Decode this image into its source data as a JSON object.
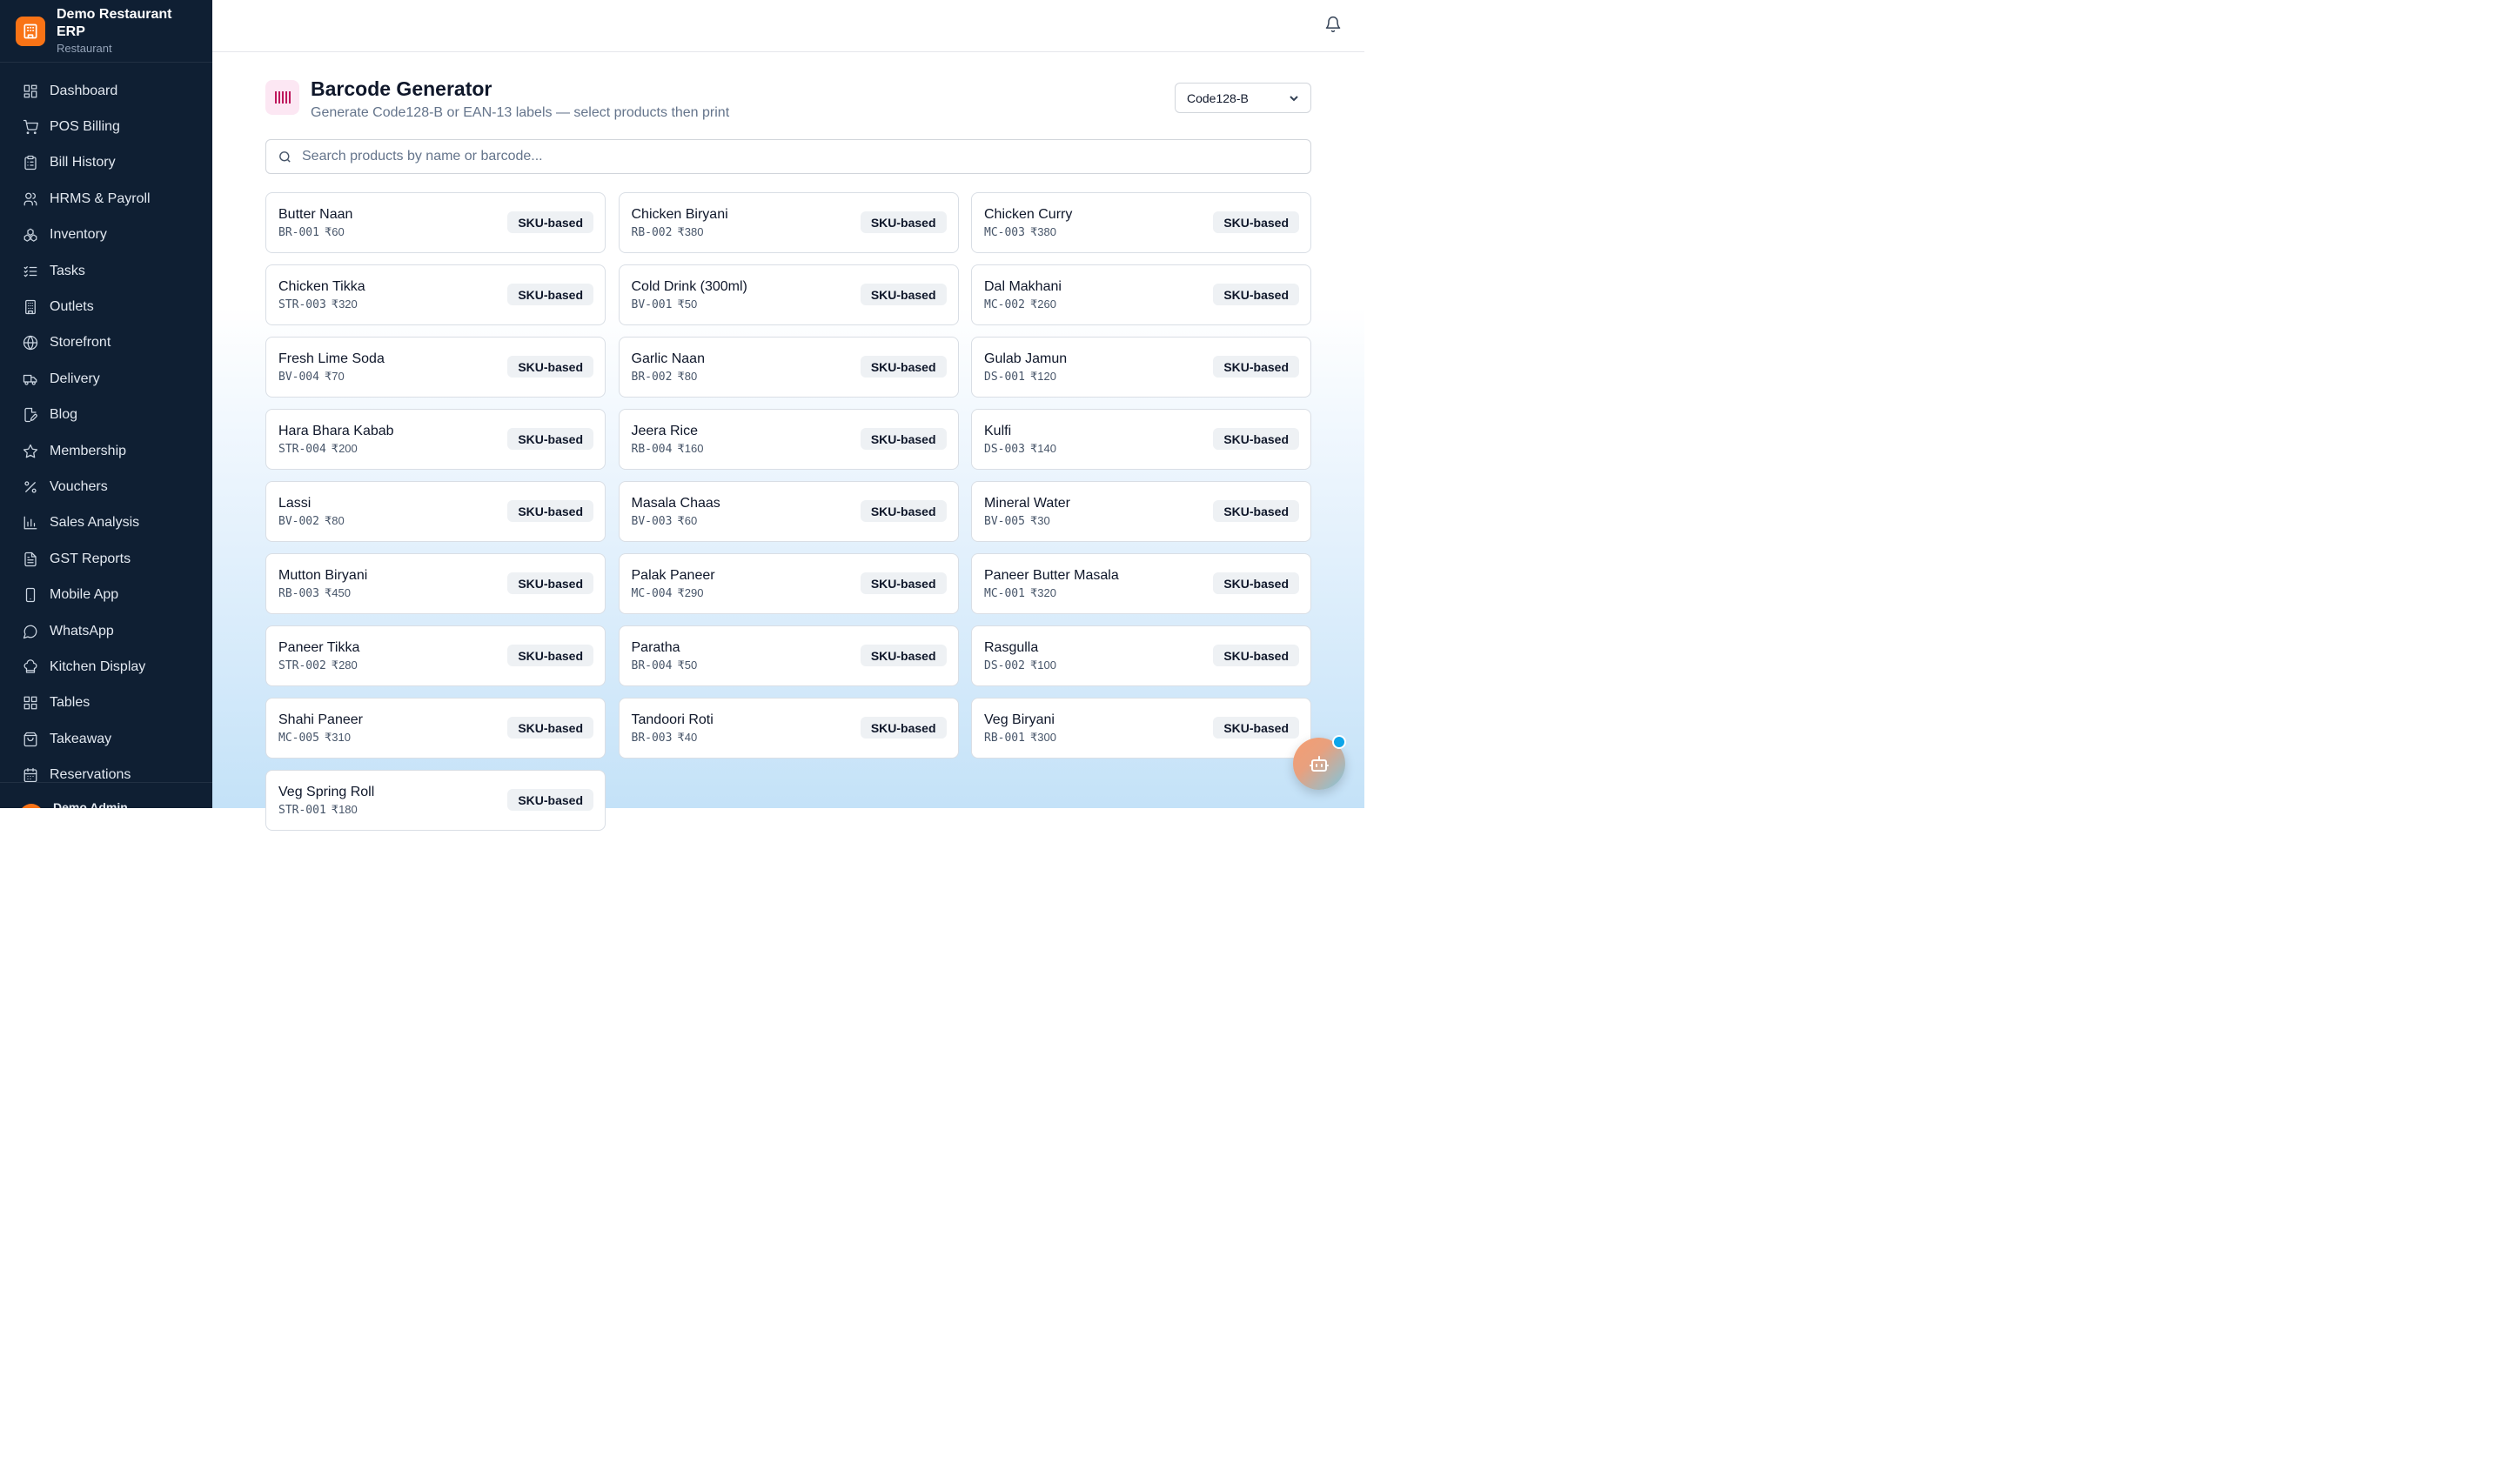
{
  "app": {
    "name": "Demo Restaurant ERP",
    "subtitle": "Restaurant"
  },
  "sidebar": {
    "items": [
      {
        "label": "Dashboard",
        "icon": "dashboard-icon"
      },
      {
        "label": "POS Billing",
        "icon": "cart-icon"
      },
      {
        "label": "Bill History",
        "icon": "clipboard-icon"
      },
      {
        "label": "HRMS & Payroll",
        "icon": "users-icon"
      },
      {
        "label": "Inventory",
        "icon": "boxes-icon"
      },
      {
        "label": "Tasks",
        "icon": "checklist-icon"
      },
      {
        "label": "Outlets",
        "icon": "building-icon"
      },
      {
        "label": "Storefront",
        "icon": "globe-icon"
      },
      {
        "label": "Delivery",
        "icon": "truck-icon"
      },
      {
        "label": "Blog",
        "icon": "file-edit-icon"
      },
      {
        "label": "Membership",
        "icon": "star-icon"
      },
      {
        "label": "Vouchers",
        "icon": "percent-icon"
      },
      {
        "label": "Sales Analysis",
        "icon": "bar-chart-icon"
      },
      {
        "label": "GST Reports",
        "icon": "file-text-icon"
      },
      {
        "label": "Mobile App",
        "icon": "smartphone-icon"
      },
      {
        "label": "WhatsApp",
        "icon": "message-circle-icon"
      },
      {
        "label": "Kitchen Display",
        "icon": "chef-hat-icon"
      },
      {
        "label": "Tables",
        "icon": "grid-icon"
      },
      {
        "label": "Takeaway",
        "icon": "shopping-bag-icon"
      },
      {
        "label": "Reservations",
        "icon": "calendar-icon"
      }
    ],
    "user_name": "Demo Admin"
  },
  "page": {
    "title": "Barcode Generator",
    "subtitle": "Generate Code128-B or EAN-13 labels — select products then print",
    "format_value": "Code128-B",
    "search_placeholder": "Search products by name or barcode..."
  },
  "products": [
    {
      "name": "Butter Naan",
      "code": "BR-001",
      "price": "₹60",
      "badge": "SKU-based"
    },
    {
      "name": "Chicken Biryani",
      "code": "RB-002",
      "price": "₹380",
      "badge": "SKU-based"
    },
    {
      "name": "Chicken Curry",
      "code": "MC-003",
      "price": "₹380",
      "badge": "SKU-based"
    },
    {
      "name": "Chicken Tikka",
      "code": "STR-003",
      "price": "₹320",
      "badge": "SKU-based"
    },
    {
      "name": "Cold Drink (300ml)",
      "code": "BV-001",
      "price": "₹50",
      "badge": "SKU-based"
    },
    {
      "name": "Dal Makhani",
      "code": "MC-002",
      "price": "₹260",
      "badge": "SKU-based"
    },
    {
      "name": "Fresh Lime Soda",
      "code": "BV-004",
      "price": "₹70",
      "badge": "SKU-based"
    },
    {
      "name": "Garlic Naan",
      "code": "BR-002",
      "price": "₹80",
      "badge": "SKU-based"
    },
    {
      "name": "Gulab Jamun",
      "code": "DS-001",
      "price": "₹120",
      "badge": "SKU-based"
    },
    {
      "name": "Hara Bhara Kabab",
      "code": "STR-004",
      "price": "₹200",
      "badge": "SKU-based"
    },
    {
      "name": "Jeera Rice",
      "code": "RB-004",
      "price": "₹160",
      "badge": "SKU-based"
    },
    {
      "name": "Kulfi",
      "code": "DS-003",
      "price": "₹140",
      "badge": "SKU-based"
    },
    {
      "name": "Lassi",
      "code": "BV-002",
      "price": "₹80",
      "badge": "SKU-based"
    },
    {
      "name": "Masala Chaas",
      "code": "BV-003",
      "price": "₹60",
      "badge": "SKU-based"
    },
    {
      "name": "Mineral Water",
      "code": "BV-005",
      "price": "₹30",
      "badge": "SKU-based"
    },
    {
      "name": "Mutton Biryani",
      "code": "RB-003",
      "price": "₹450",
      "badge": "SKU-based"
    },
    {
      "name": "Palak Paneer",
      "code": "MC-004",
      "price": "₹290",
      "badge": "SKU-based"
    },
    {
      "name": "Paneer Butter Masala",
      "code": "MC-001",
      "price": "₹320",
      "badge": "SKU-based"
    },
    {
      "name": "Paneer Tikka",
      "code": "STR-002",
      "price": "₹280",
      "badge": "SKU-based"
    },
    {
      "name": "Paratha",
      "code": "BR-004",
      "price": "₹50",
      "badge": "SKU-based"
    },
    {
      "name": "Rasgulla",
      "code": "DS-002",
      "price": "₹100",
      "badge": "SKU-based"
    },
    {
      "name": "Shahi Paneer",
      "code": "MC-005",
      "price": "₹310",
      "badge": "SKU-based"
    },
    {
      "name": "Tandoori Roti",
      "code": "BR-003",
      "price": "₹40",
      "badge": "SKU-based"
    },
    {
      "name": "Veg Biryani",
      "code": "RB-001",
      "price": "₹300",
      "badge": "SKU-based"
    },
    {
      "name": "Veg Spring Roll",
      "code": "STR-001",
      "price": "₹180",
      "badge": "SKU-based"
    }
  ],
  "colors": {
    "sidebar_bg": "#0f1f33",
    "brand_accent": "#f97316",
    "header_icon_bg": "#fce7f3",
    "header_icon": "#be185d"
  }
}
